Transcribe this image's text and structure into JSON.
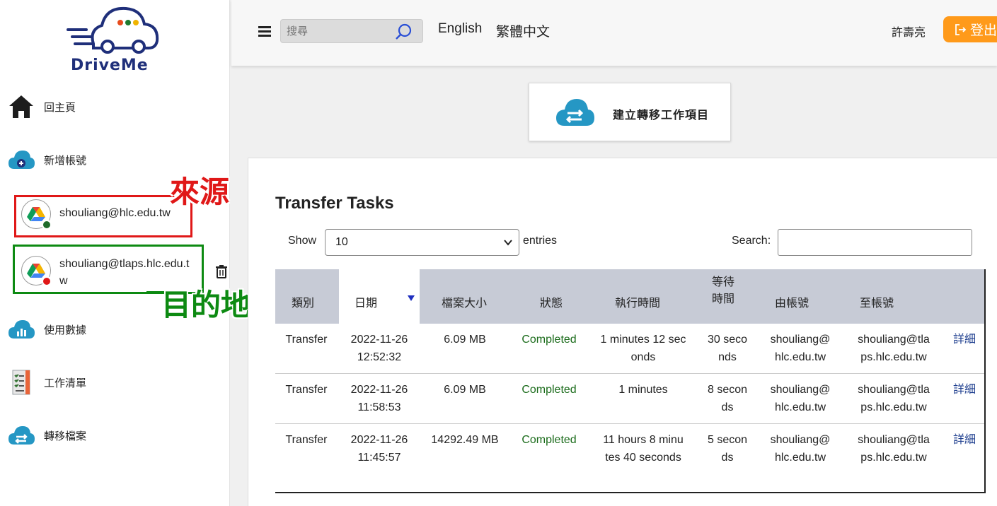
{
  "brand": {
    "logo_text": "DriveMe",
    "primary_color": "#1f2f7a",
    "accent_color": "#ff9a1a"
  },
  "sidebar": {
    "items": [
      {
        "label": "回主頁",
        "icon": "home-icon"
      },
      {
        "label": "新增帳號",
        "icon": "cloud-plus-icon"
      },
      {
        "label": "使用數據",
        "icon": "cloud-chart-icon"
      },
      {
        "label": "工作清單",
        "icon": "checklist-icon"
      },
      {
        "label": "轉移檔案",
        "icon": "cloud-transfer-icon"
      }
    ],
    "accounts": [
      {
        "email": "shouliang@hlc.edu.tw",
        "status_color": "#1e6b2a"
      },
      {
        "email_line1": "shouliang@tlaps.hlc.edu.t",
        "email_line2": "w",
        "status_color": "#e01818"
      }
    ],
    "annotations": {
      "source": "來源",
      "destination": "目的地"
    }
  },
  "topbar": {
    "search_placeholder": "搜尋",
    "lang_en": "English",
    "lang_zh": "繁體中文",
    "user_name": "許壽亮",
    "logout_label": "登出"
  },
  "create_card": {
    "label": "建立轉移工作項目"
  },
  "panel": {
    "title": "Transfer Tasks",
    "show_label": "Show",
    "entries_value": "10",
    "entries_label": "entries",
    "search_label": "Search:"
  },
  "table": {
    "headers": {
      "type": "類別",
      "date": "日期",
      "size": "檔案大小",
      "status": "狀態",
      "exec": "執行時間",
      "wait1": "等待",
      "wait2": "時間",
      "from": "由帳號",
      "to": "至帳號"
    },
    "rows": [
      {
        "type": "Transfer",
        "date1": "2022-11-26",
        "date2": "12:52:32",
        "size": "6.09 MB",
        "status": "Completed",
        "exec1": "1 minutes 12 sec",
        "exec2": "onds",
        "wait1": "30 seco",
        "wait2": "nds",
        "from1": "shouliang@",
        "from2": "hlc.edu.tw",
        "to1": "shouliang@tla",
        "to2": "ps.hlc.edu.tw",
        "detail": "詳細"
      },
      {
        "type": "Transfer",
        "date1": "2022-11-26",
        "date2": "11:58:53",
        "size": "6.09 MB",
        "status": "Completed",
        "exec1": "1 minutes",
        "exec2": "",
        "wait1": "8 secon",
        "wait2": "ds",
        "from1": "shouliang@",
        "from2": "hlc.edu.tw",
        "to1": "shouliang@tla",
        "to2": "ps.hlc.edu.tw",
        "detail": "詳細"
      },
      {
        "type": "Transfer",
        "date1": "2022-11-26",
        "date2": "11:45:57",
        "size": "14292.49 MB",
        "status": "Completed",
        "exec1": "11 hours 8 minu",
        "exec2": "tes 40 seconds",
        "wait1": "5 secon",
        "wait2": "ds",
        "from1": "shouliang@",
        "from2": "hlc.edu.tw",
        "to1": "shouliang@tla",
        "to2": "ps.hlc.edu.tw",
        "detail": "詳細"
      }
    ]
  }
}
